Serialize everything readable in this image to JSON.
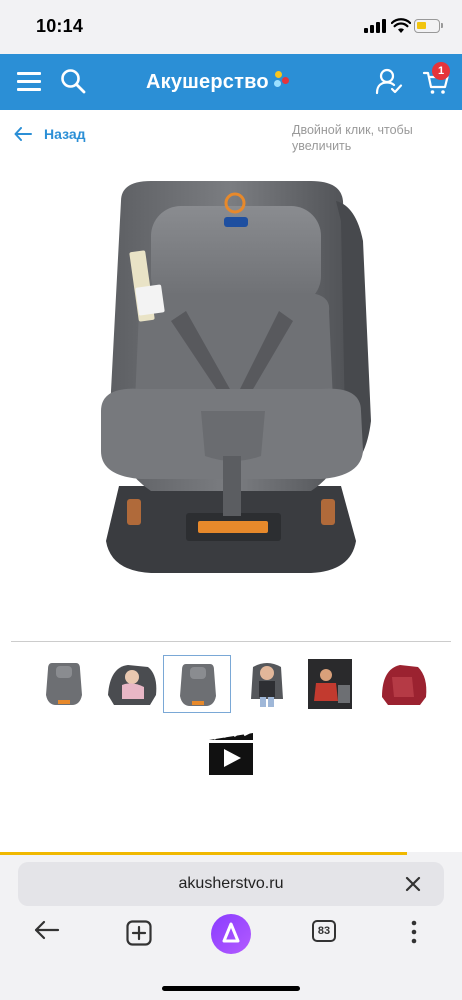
{
  "status": {
    "time": "10:14"
  },
  "header": {
    "logo_text": "Акушерство",
    "cart_count": "1",
    "colors": {
      "bg": "#2b8fd6",
      "badge": "#e5343b"
    }
  },
  "nav": {
    "back_label": "Назад",
    "zoom_hint": "Двойной клик, чтобы увеличить"
  },
  "gallery": {
    "thumbnails": [
      {
        "name": "car-seat-front-grey"
      },
      {
        "name": "car-seat-side-with-baby"
      },
      {
        "name": "car-seat-front-grey-selected",
        "selected": true
      },
      {
        "name": "car-seat-with-child"
      },
      {
        "name": "car-seat-in-car"
      },
      {
        "name": "car-seat-red"
      }
    ],
    "video_icon": "video-play-icon"
  },
  "browser": {
    "url": "akusherstvo.ru",
    "tabs_count": "83",
    "load_progress": 0.88
  }
}
